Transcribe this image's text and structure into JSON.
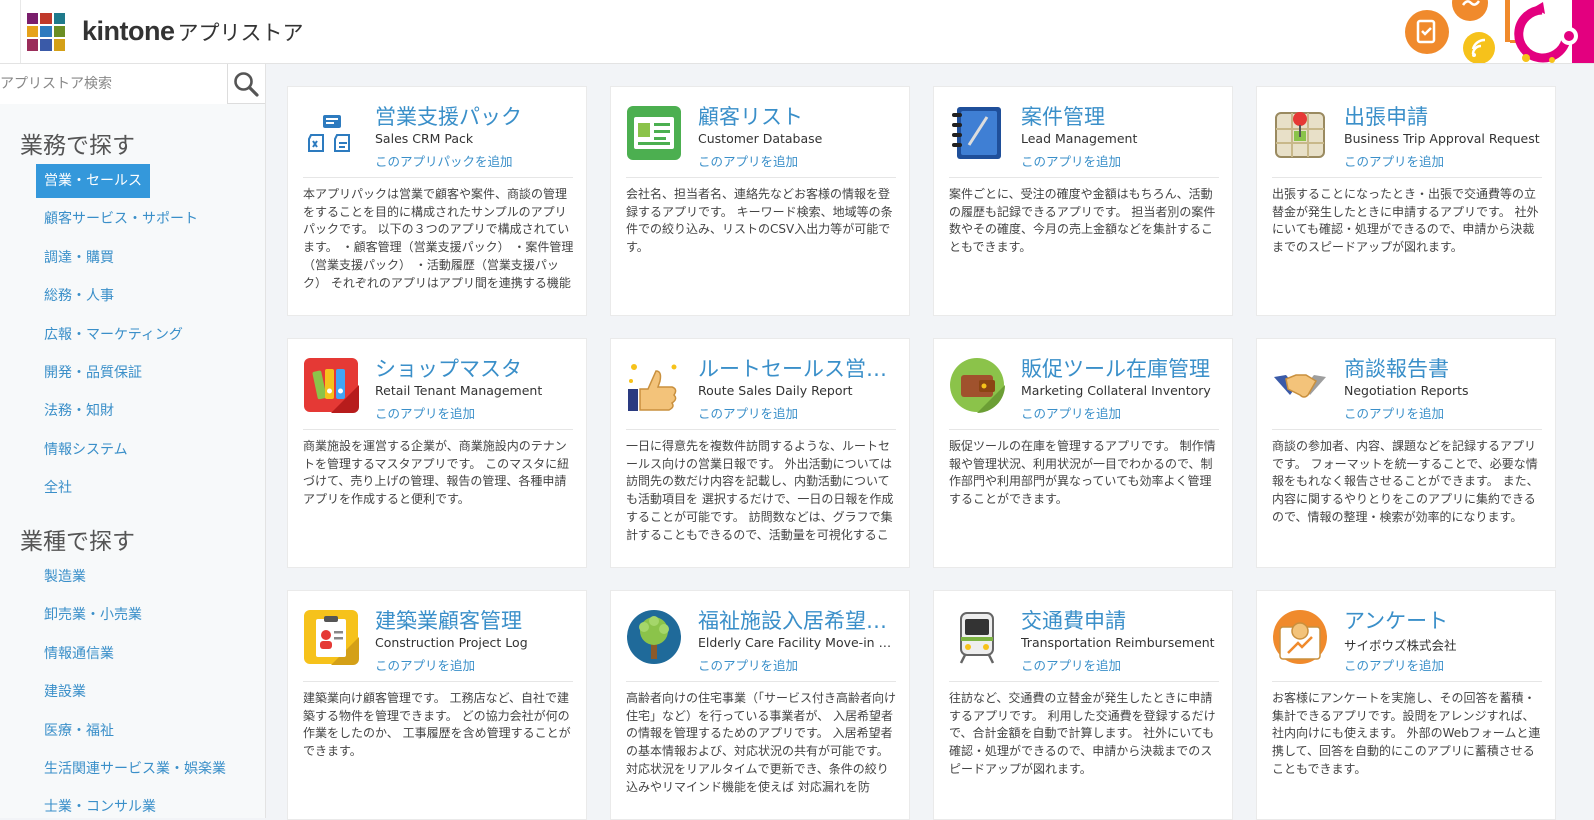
{
  "header": {
    "brand_main": "kintone",
    "brand_sub": "アプリストア",
    "logo_colors": [
      "#7a1e6c",
      "#c0392b",
      "#1f7a8c",
      "#e6a21c",
      "#2d7bbf",
      "#6b8e23",
      "#9b2d5a",
      "#3a5aa8",
      "#d4a017"
    ],
    "accent_color": "#f08a2c"
  },
  "search": {
    "placeholder": "アプリストア検索",
    "icon": "search-icon"
  },
  "sidebar": {
    "section_business": "業務で探す",
    "business_items": [
      {
        "label": "営業・セールス",
        "active": true
      },
      {
        "label": "顧客サービス・サポート"
      },
      {
        "label": "調達・購買"
      },
      {
        "label": "総務・人事"
      },
      {
        "label": "広報・マーケティング"
      },
      {
        "label": "開発・品質保証"
      },
      {
        "label": "法務・知財"
      },
      {
        "label": "情報システム"
      },
      {
        "label": "全社"
      }
    ],
    "section_industry": "業種で探す",
    "industry_items": [
      {
        "label": "製造業"
      },
      {
        "label": "卸売業・小売業"
      },
      {
        "label": "情報通信業"
      },
      {
        "label": "建設業"
      },
      {
        "label": "医療・福祉"
      },
      {
        "label": "生活関連サービス業・娯楽業"
      },
      {
        "label": "士業・コンサル業"
      }
    ],
    "active_color": "#3498db"
  },
  "cards": [
    {
      "title": "営業支援パック",
      "subtitle": "Sales CRM Pack",
      "add": "このアプリパックを追加",
      "icon": "app-pack-icon",
      "desc": "本アプリパックは営業で顧客や案件、商談の管理をすることを目的に構成されたサンプルのアプリパックです。 以下の３つのアプリで構成されています。 ・顧客管理（営業支援パック） ・案件管理（営業支援パック） ・活動履歴（営業支援パック） それぞれのアプリはアプリ間を連携する機能"
    },
    {
      "title": "顧客リスト",
      "subtitle": "Customer Database",
      "add": "このアプリを追加",
      "icon": "address-card-icon",
      "desc": "会社名、担当者名、連絡先などお客様の情報を登録するアプリです。 キーワード検索、地域等の条件での絞り込み、リストのCSV入出力等が可能です。"
    },
    {
      "title": "案件管理",
      "subtitle": "Lead Management",
      "add": "このアプリを追加",
      "icon": "notebook-icon",
      "desc": "案件ごとに、受注の確度や金額はもちろん、活動の履歴も記録できるアプリです。 担当者別の案件数やその確度、今月の売上金額などを集計することもできます。"
    },
    {
      "title": "出張申請",
      "subtitle": "Business Trip Approval Request",
      "add": "このアプリを追加",
      "icon": "map-pin-icon",
      "desc": "出張することになったとき・出張で交通費等の立替金が発生したときに申請するアプリです。 社外にいても確認・処理ができるので、申請から決裁までのスピードアップが図れます。"
    },
    {
      "title": "ショップマスタ",
      "subtitle": "Retail Tenant Management",
      "add": "このアプリを追加",
      "icon": "binders-icon",
      "desc": "商業施設を運営する企業が、商業施設内のテナントを管理するマスタアプリです。 このマスタに紐づけて、売り上げの管理、報告の管理、各種申請アプリを作成すると便利です。"
    },
    {
      "title": "ルートセールス営業日報",
      "subtitle": "Route Sales Daily Report",
      "add": "このアプリを追加",
      "icon": "thumbs-up-icon",
      "desc": "一日に得意先を複数件訪問するような、ルートセールス向けの営業日報です。 外出活動については訪問先の数だけ内容を記載し、内勤活動についても活動項目を 選択するだけで、一日の日報を作成することが可能です。 訪問数などは、グラフで集計することもできるので、活動量を可視化するこ"
    },
    {
      "title": "販促ツール在庫管理",
      "subtitle": "Marketing Collateral Inventory",
      "add": "このアプリを追加",
      "icon": "wallet-icon",
      "desc": "販促ツールの在庫を管理するアプリです。 制作情報や管理状況、利用状況が一目でわかるので、制作部門や利用部門が異なっていても効率よく管理することができます。"
    },
    {
      "title": "商談報告書",
      "subtitle": "Negotiation Reports",
      "add": "このアプリを追加",
      "icon": "handshake-icon",
      "desc": "商談の参加者、内容、課題などを記録するアプリです。 フォーマットを統一することで、必要な情報をもれなく報告させることができます。 また、内容に関するやりとりをこのアプリに集約できるので、情報の整理・検索が効率的になります。"
    },
    {
      "title": "建築業顧客管理",
      "subtitle": "Construction Project Log",
      "add": "このアプリを追加",
      "icon": "clipboard-user-icon",
      "desc": "建築業向け顧客管理です。 工務店など、自社で建築する物件を管理できます。 どの協力会社が何の作業をしたのか、 工事履歴を含め管理することができます。"
    },
    {
      "title": "福祉施設入居希望者管理",
      "subtitle": "Elderly Care Facility Move-in Candidates",
      "add": "このアプリを追加",
      "icon": "tree-icon",
      "desc": "高齢者向けの住宅事業（「サービス付き高齢者向け住宅」など）を行っている事業者が、 入居希望者の情報を管理するためのアプリです。 入居希望者の基本情報および、対応状況の共有が可能です。 対応状況をリアルタイムで更新でき、条件の絞り込みやリマインド機能を使えば 対応漏れを防"
    },
    {
      "title": "交通費申請",
      "subtitle": "Transportation Reimbursement",
      "add": "このアプリを追加",
      "icon": "train-icon",
      "desc": "往訪など、交通費の立替金が発生したときに申請するアプリです。 利用した交通費を登録するだけで、合計金額を自動で計算します。 社外にいても確認・処理ができるので、申請から決裁までのスピードアップが図れます。"
    },
    {
      "title": "アンケート",
      "subtitle": "サイボウズ株式会社",
      "add": "このアプリを追加",
      "icon": "survey-icon",
      "desc": "お客様にアンケートを実施し、その回答を蓄積・集計できるアプリです。設問をアレンジすれば、社内向けにも使えます。 外部のWebフォームと連携して、回答を自動的にこのアプリに蓄積させることもできます。"
    }
  ]
}
